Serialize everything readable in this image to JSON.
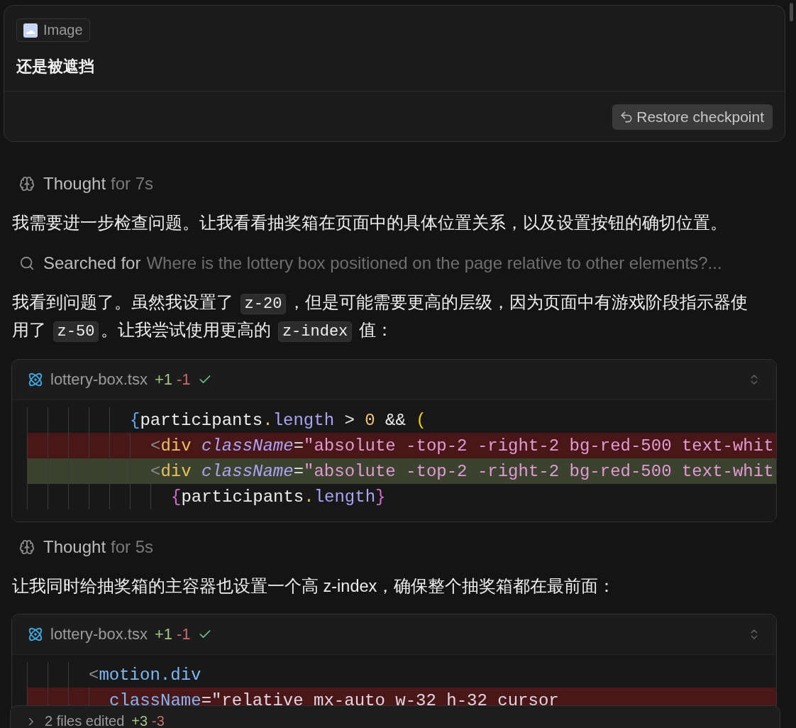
{
  "user_message": {
    "attachment": {
      "label": "Image"
    },
    "text": "还是被遮挡",
    "restore_button": "Restore checkpoint"
  },
  "steps": [
    {
      "kind": "thought",
      "label": "Thought",
      "duration": "for 7s"
    },
    {
      "kind": "paragraph",
      "segments": [
        {
          "text": "我需要进一步检查问题。让我看看抽奖箱在页面中的具体位置关系，以及设置按钮的确切位置。",
          "code": false
        }
      ]
    },
    {
      "kind": "search",
      "label": "Searched for",
      "query": "Where is the lottery box positioned on the page relative to other elements?..."
    },
    {
      "kind": "paragraph",
      "segments": [
        {
          "text": "我看到问题了。虽然我设置了 ",
          "code": false
        },
        {
          "text": "z-20",
          "code": true
        },
        {
          "text": "，但是可能需要更高的层级，因为页面中有游戏阶段指示器使用了 ",
          "code": false
        },
        {
          "text": "z-50",
          "code": true
        },
        {
          "text": "。让我尝试使用更高的 ",
          "code": false
        },
        {
          "text": "z-index",
          "code": true
        },
        {
          "text": " 值：",
          "code": false
        }
      ]
    },
    {
      "kind": "diff",
      "file": "lottery-box.tsx",
      "added": "+1",
      "removed": "-1",
      "applied": true,
      "lines": [
        {
          "kind": "context",
          "tokens": [
            {
              "kind": "brace",
              "text": "          {"
            },
            {
              "kind": "ident",
              "text": "participants"
            },
            {
              "kind": "dot",
              "text": "."
            },
            {
              "kind": "prop",
              "text": "length"
            },
            {
              "kind": "plain",
              "text": " > "
            },
            {
              "kind": "number",
              "text": "0"
            },
            {
              "kind": "plain",
              "text": " && "
            },
            {
              "kind": "paren",
              "text": "("
            }
          ]
        },
        {
          "kind": "removed",
          "tokens": [
            {
              "kind": "angle",
              "text": "            <"
            },
            {
              "kind": "tag",
              "text": "div"
            },
            {
              "kind": "attr",
              "text": " className"
            },
            {
              "kind": "plain",
              "text": "="
            },
            {
              "kind": "string",
              "text": "\"absolute -top-2 -right-2 bg-red-500 text-whit"
            }
          ]
        },
        {
          "kind": "added",
          "tokens": [
            {
              "kind": "angle",
              "text": "            <"
            },
            {
              "kind": "tag",
              "text": "div"
            },
            {
              "kind": "attr",
              "text": " className"
            },
            {
              "kind": "plain",
              "text": "="
            },
            {
              "kind": "string",
              "text": "\"absolute -top-2 -right-2 bg-red-500 text-whit"
            }
          ]
        },
        {
          "kind": "context",
          "tokens": [
            {
              "kind": "jsx-brace",
              "text": "              {"
            },
            {
              "kind": "ident",
              "text": "participants"
            },
            {
              "kind": "dot",
              "text": "."
            },
            {
              "kind": "prop",
              "text": "length"
            },
            {
              "kind": "jsx-brace",
              "text": "}"
            }
          ]
        }
      ]
    },
    {
      "kind": "thought",
      "label": "Thought",
      "duration": "for 5s"
    },
    {
      "kind": "paragraph",
      "segments": [
        {
          "text": "让我同时给抽奖箱的主容器也设置一个高 z-index，确保整个抽奖箱都在最前面：",
          "code": false
        }
      ]
    },
    {
      "kind": "diff",
      "file": "lottery-box.tsx",
      "added": "+1",
      "removed": "-1",
      "applied": true,
      "lines": [
        {
          "kind": "context",
          "tokens": [
            {
              "kind": "angle",
              "text": "      <"
            },
            {
              "kind": "component",
              "text": "motion.div"
            }
          ]
        },
        {
          "kind": "removed",
          "tokens": [
            {
              "kind": "attr-plain",
              "text": "        className"
            },
            {
              "kind": "plain",
              "text": "="
            },
            {
              "kind": "string-plain",
              "text": "\"relative mx-auto w-32 h-32 cursor"
            }
          ]
        }
      ]
    }
  ],
  "summary_bar": {
    "label": "2 files edited",
    "added": "+3",
    "removed": "-3",
    "expanded": false
  }
}
